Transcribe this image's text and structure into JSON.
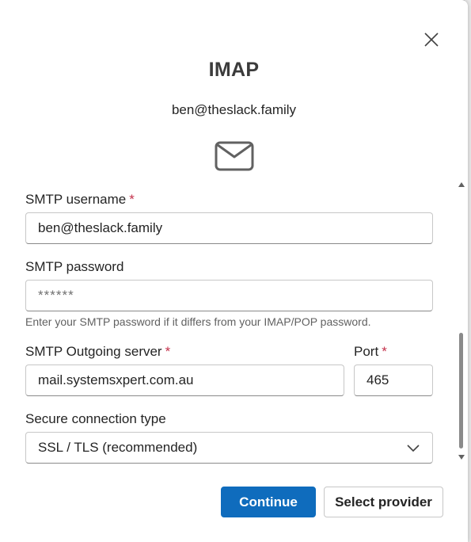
{
  "dialog": {
    "title": "IMAP",
    "email": "ben@theslack.family"
  },
  "form": {
    "smtp_username": {
      "label": "SMTP username",
      "required_mark": "*",
      "value": "ben@theslack.family"
    },
    "smtp_password": {
      "label": "SMTP password",
      "placeholder": "******",
      "help": "Enter your SMTP password if it differs from your IMAP/POP password."
    },
    "smtp_server": {
      "label": "SMTP Outgoing server",
      "required_mark": "*",
      "value": "mail.systemsxpert.com.au"
    },
    "port": {
      "label": "Port",
      "required_mark": "*",
      "value": "465"
    },
    "secure_connection": {
      "label": "Secure connection type",
      "selected": "SSL / TLS (recommended)"
    }
  },
  "buttons": {
    "continue": "Continue",
    "select_provider": "Select provider"
  },
  "icons": {
    "close": "close-icon",
    "mail": "mail-icon",
    "dropdown": "chevron-down-icon"
  },
  "colors": {
    "primary": "#0f6cbd",
    "required": "#c4314b"
  }
}
